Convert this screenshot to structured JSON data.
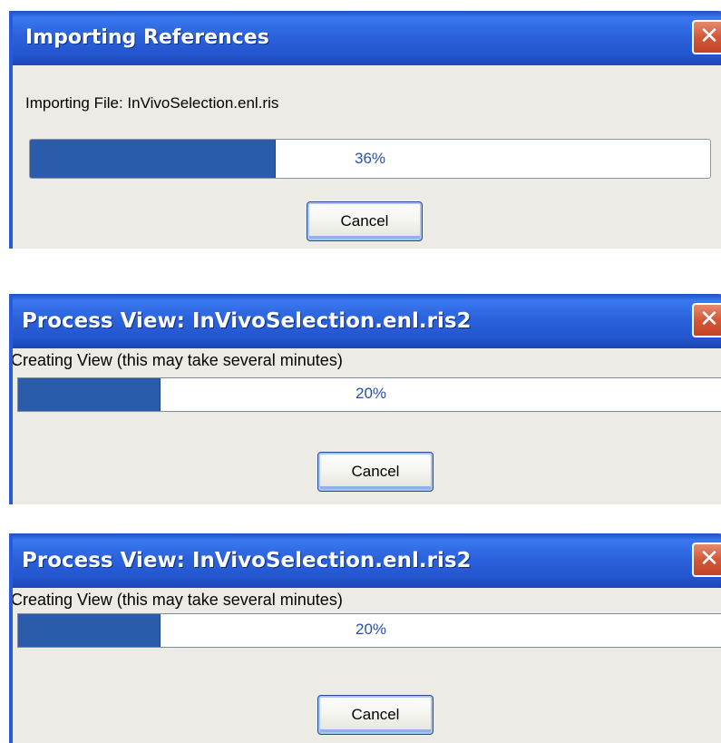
{
  "dialogs": [
    {
      "title": "Importing References",
      "message": "Importing File: InVivoSelection.enl.ris",
      "progress_percent": 36,
      "progress_label": "36%",
      "cancel_label": "Cancel",
      "close_glyph": "✕"
    },
    {
      "title": "Process View: InVivoSelection.enl.ris2",
      "message": "Creating View (this may take several minutes)",
      "progress_percent": 20,
      "progress_label": "20%",
      "cancel_label": "Cancel",
      "close_glyph": "✕"
    },
    {
      "title": "Process View: InVivoSelection.enl.ris2",
      "message": "Creating View (this may take several minutes)",
      "progress_percent": 20,
      "progress_label": "20%",
      "cancel_label": "Cancel",
      "close_glyph": "✕"
    }
  ],
  "colors": {
    "titlebar": "#2b63dc",
    "progress_fill": "#2a5cab",
    "progress_text": "#284fa8",
    "close_button": "#d4573a",
    "dialog_background": "#ecebe6"
  }
}
